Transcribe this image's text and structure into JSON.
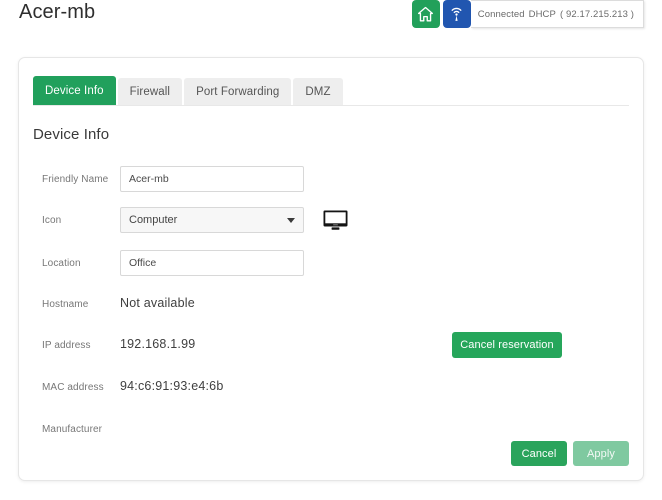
{
  "header": {
    "title": "Acer-mb",
    "status": {
      "home_icon": "home-icon",
      "wifi_icon": "wifi-signal-icon",
      "connection_state": "Connected",
      "connection_mode": "DHCP",
      "ip": "( 92.17.215.213 )"
    }
  },
  "tabs": [
    {
      "label": "Device Info",
      "active": true
    },
    {
      "label": "Firewall",
      "active": false
    },
    {
      "label": "Port Forwarding",
      "active": false
    },
    {
      "label": "DMZ",
      "active": false
    }
  ],
  "section": {
    "title": "Device Info"
  },
  "form": {
    "friendly_name": {
      "label": "Friendly Name",
      "value": "Acer-mb",
      "placeholder": ""
    },
    "icon": {
      "label": "Icon",
      "value": "Computer",
      "options": [
        "Computer"
      ],
      "glyph": "monitor-icon"
    },
    "location": {
      "label": "Location",
      "value": "Office",
      "placeholder": ""
    },
    "hostname": {
      "label": "Hostname",
      "value": "Not available"
    },
    "ip_address": {
      "label": "IP address",
      "value": "192.168.1.99"
    },
    "mac_address": {
      "label": "MAC address",
      "value": "94:c6:91:93:e4:6b"
    },
    "manufacturer": {
      "label": "Manufacturer",
      "value": ""
    }
  },
  "buttons": {
    "cancel_reservation": "Cancel reservation",
    "cancel": "Cancel",
    "apply": "Apply"
  },
  "colors": {
    "accent_green": "#21a05c",
    "reserve_green": "#26a65b",
    "apply_disabled_green": "#7fc9a0",
    "home_icon_green": "#22a05a",
    "wifi_icon_blue": "#2156b0",
    "tab_inactive_gray": "#eeeeee"
  }
}
